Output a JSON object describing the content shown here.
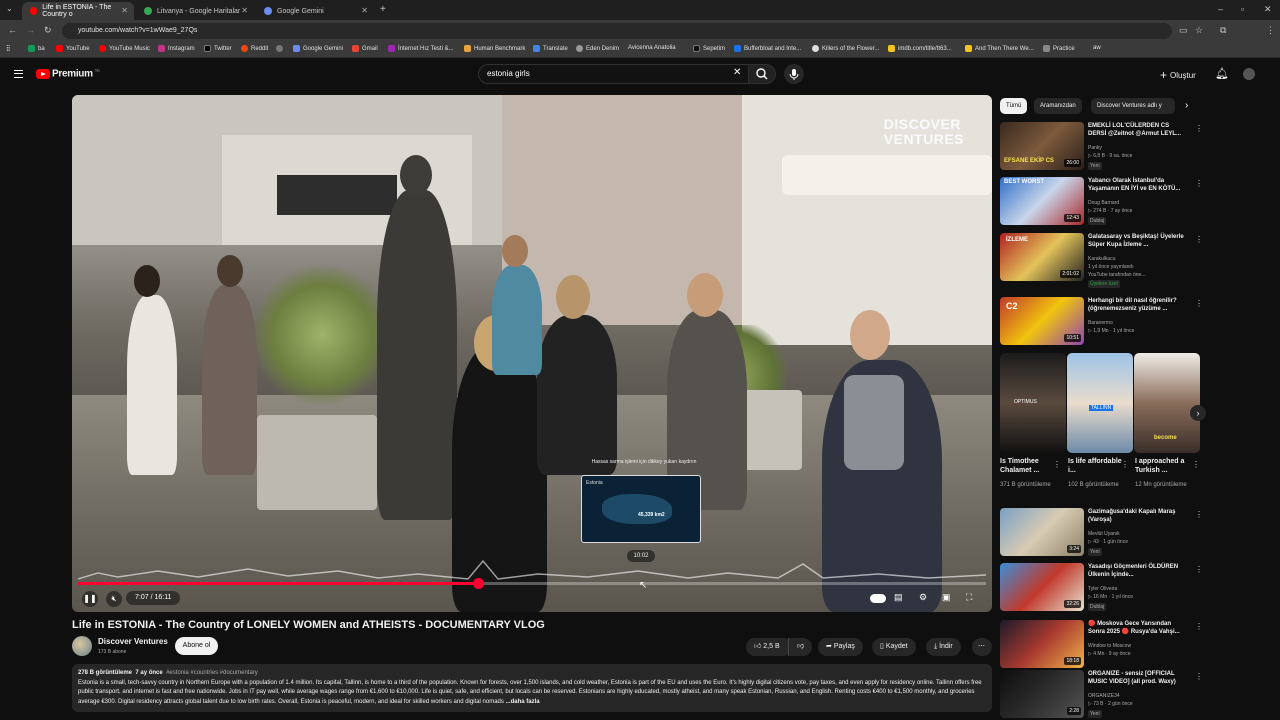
{
  "browser": {
    "tabs": [
      {
        "title": "Life in ESTONIA - The Country o",
        "active": true
      },
      {
        "title": "Litvanya - Google Haritalar",
        "active": false
      },
      {
        "title": "Google Gemini",
        "active": false
      }
    ],
    "url": "youtube.com/watch?v=1wWae9_27Qs",
    "bookmarks": [
      "ba",
      "YouTube",
      "YouTube Music",
      "Instagram",
      "Twitter",
      "Reddit",
      "Google Gemini",
      "Gmail",
      "İnternet Hız Testi &...",
      "Human Benchmark",
      "Translate",
      "Eden Denim",
      "Avicenna Anatolia",
      "Sepetim",
      "Bufferbloat and Inte...",
      "Killers of the Flower...",
      "imdb.com/title/tt63...",
      "And Then There We...",
      "Practice",
      "aw"
    ]
  },
  "header": {
    "brand": "Premium",
    "region": "TR",
    "search_value": "estonia girls",
    "create_label": "Oluştur"
  },
  "player": {
    "watermark_line1": "DISCOVER",
    "watermark_line2": "VENTURES",
    "time": "7:07 / 16:11",
    "progress": 0.44,
    "hover_time": "10:02",
    "hover_tip": "Hassas sarma işlemi için dikkey yukarı kaydırın",
    "preview_label": "Estonia",
    "preview_value": "45,339 km2"
  },
  "video": {
    "title": "Life in ESTONIA - The Country of LONELY WOMEN and ATHEISTS - DOCUMENTARY VLOG",
    "channel": "Discover Ventures",
    "subscribers": "173 B abone",
    "subscribe_label": "Abone ol",
    "likes": "2,5 B",
    "share_label": "Paylaş",
    "save_label": "Kaydet",
    "download_label": "İndir",
    "views": "278 B görüntüleme",
    "age": "7 ay önce",
    "tags": "#estonia #countries #documentary",
    "description": "Estonia is a small, tech-savvy country in Northern Europe with a population of 1.4 million. Its capital, Tallinn, is home to a third of the population. Known for forests, over 1,500 islands, and cold weather, Estonia is part of the EU and uses the Euro. It's highly digital citizens vote, pay taxes, and even apply for residency online. Tallinn offers free public transport, and internet is fast and free nationwide. Jobs in IT pay well, while average wages range from €1,600 to €10,000. Life is quiet, safe, and efficient, but locals can be reserved. Estonians are highly educated, mostly atheist, and many speak Estonian, Russian, and English. Renting costs €400 to €1,500 monthly, and groceries average €300. Digital residency attracts global talent due to low birth rates. Overall, Estonia is peaceful, modern, and ideal for skilled workers and digital nomads",
    "more_label": "...daha fazla"
  },
  "sidebar": {
    "chips": [
      "Tümü",
      "Aramanızdan",
      "Discover Ventures adlı y"
    ],
    "recs": [
      {
        "title": "EMEKLİ LOL'CÜLERDEN CS DERSİ @Zeitnot @Armut LEYL...",
        "channel": "Panky",
        "meta": "▷ 6,8 B · 9 sa. önce",
        "badge": "Yeni",
        "duration": "26:00",
        "thumb_text": "EFSANE EKİP CS"
      },
      {
        "title": "Yabancı Olarak İstanbul'da Yaşamanın EN İYİ ve EN KÖTÜ...",
        "channel": "Doug Barnard",
        "meta": "▷ 274 B · 7 ay önce",
        "badge": "Dublaj",
        "duration": "12:43",
        "thumb_text": "BEST WORST"
      },
      {
        "title": "Galatasaray vs Beşiktaş! Üyelerle Süper Kupa İzleme ...",
        "channel": "Karakulkucu",
        "meta": "1 yıl önce yayınlandı",
        "meta2": "YouTube tarafından öne...",
        "badge": "Üyelere özel",
        "duration": "2:01:02",
        "thumb_text": "İZLEME"
      },
      {
        "title": "Herhangi bir dil nasıl öğrenilir? (öğrenemezseniz yüzüme ...",
        "channel": "Baranermo",
        "meta": "▷ 1,9 Mn · 1 yıl önce",
        "badge": "",
        "duration": "10:51",
        "thumb_text": "C2"
      },
      {
        "title": "Gazimağusa'daki Kapalı Maraş (Varoşa)",
        "channel": "Mevlüt Uyanık",
        "meta": "▷ 43 · 1 gün önce",
        "badge": "Yeni",
        "duration": "3:24",
        "thumb_text": ""
      },
      {
        "title": "Yasadışı Göçmenleri ÖLDÜREN Ülkenin İçinde...",
        "channel": "Tyler Oliveira",
        "meta": "▷ 16 Mn · 1 yıl önce",
        "badge": "Dublaj",
        "duration": "32:26",
        "thumb_text": ""
      },
      {
        "title": "🔴 Moskova Gece Yarısından Sonra 2025 🔴 Rusya'da Vahşi...",
        "channel": "Window to Moscow",
        "meta": "▷ 4 Mn · 9 ay önce",
        "badge": "",
        "duration": "18:18",
        "thumb_text": ""
      },
      {
        "title": "ORGANIZE - sensiz [OFFICIAL MUSIC VIDEO] (all prod. Waxy)",
        "channel": "ORGANIZE34",
        "meta": "▷ 73 B · 2 gün önce",
        "badge": "Yeni",
        "duration": "2:28",
        "thumb_text": ""
      }
    ],
    "shorts": [
      {
        "title": "Is Timothee Chalamet ...",
        "views": "371 B görüntüleme",
        "thumb_text": "OPTIMUS"
      },
      {
        "title": "Is life affordable i...",
        "views": "102 B görüntüleme",
        "thumb_text": "TALLINN"
      },
      {
        "title": "I approached a Turkish ...",
        "views": "12 Mn görüntüleme",
        "thumb_text": "become"
      }
    ]
  }
}
